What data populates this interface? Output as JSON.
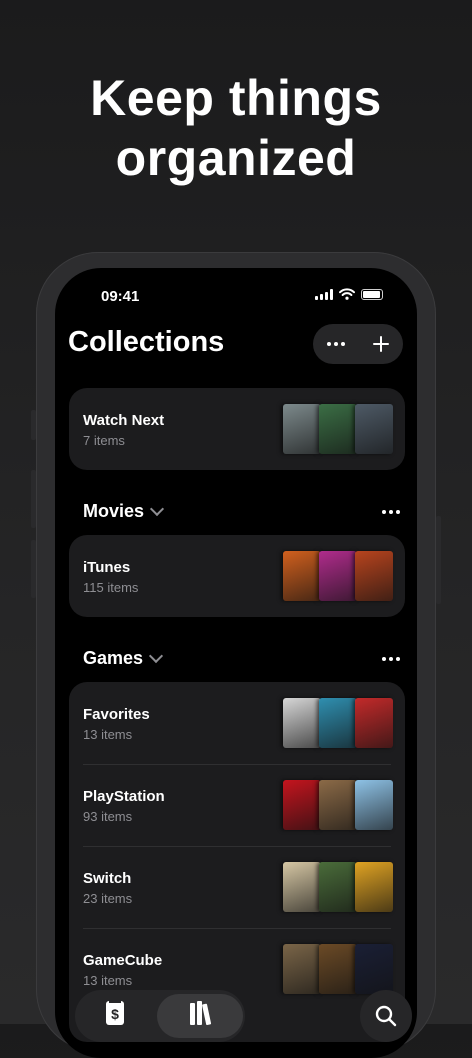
{
  "headline": {
    "line1": "Keep things",
    "line2": "organized"
  },
  "status_bar": {
    "time": "09:41"
  },
  "header": {
    "title": "Collections"
  },
  "watch_next": {
    "name": "Watch Next",
    "count": "7 items",
    "posters": [
      {
        "color": "#7d8a8c"
      },
      {
        "color": "#3b6e45"
      },
      {
        "color": "#4e5a66"
      }
    ]
  },
  "movies": {
    "label": "Movies",
    "rows": [
      {
        "name": "iTunes",
        "count": "115 items",
        "posters": [
          {
            "color": "#d1601e"
          },
          {
            "color": "#b02c8c"
          },
          {
            "color": "#b8441e"
          }
        ]
      }
    ]
  },
  "games": {
    "label": "Games",
    "rows": [
      {
        "name": "Favorites",
        "count": "13 items",
        "posters": [
          {
            "color": "#d7d7d7"
          },
          {
            "color": "#2f8fb0"
          },
          {
            "color": "#c32a2a"
          }
        ]
      },
      {
        "name": "PlayStation",
        "count": "93 items",
        "posters": [
          {
            "color": "#c4141e"
          },
          {
            "color": "#8b6a47"
          },
          {
            "color": "#8ec2e6"
          }
        ]
      },
      {
        "name": "Switch",
        "count": "23 items",
        "posters": [
          {
            "color": "#d6c7a4"
          },
          {
            "color": "#4a6c3a"
          },
          {
            "color": "#e0a323"
          }
        ]
      },
      {
        "name": "GameCube",
        "count": "13 items",
        "posters": [
          {
            "color": "#7a6548"
          },
          {
            "color": "#6b4a26"
          },
          {
            "color": "#1a1f35"
          }
        ]
      }
    ]
  },
  "icons": {
    "more": "more-dots-icon",
    "add": "plus-icon",
    "chevron": "chevron-down-icon",
    "tab_store": "store-tag-icon",
    "tab_library": "library-books-icon",
    "search": "search-icon"
  }
}
